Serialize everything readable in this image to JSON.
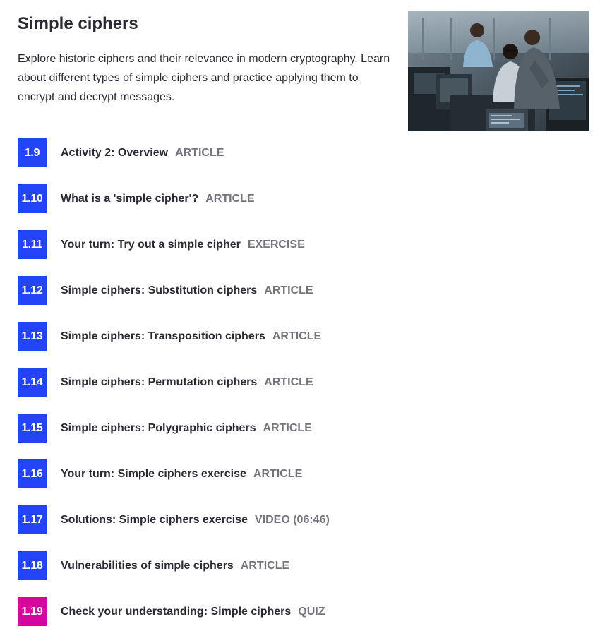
{
  "course": {
    "title": "Simple ciphers",
    "description": "Explore historic ciphers and their relevance in modern cryptography. Learn about different types of simple ciphers and practice applying them to encrypt and decrypt messages."
  },
  "colors": {
    "step_badge": "#2443f5",
    "quiz_badge": "#d4089e",
    "type_label": "#74737a",
    "text": "#2b2a33"
  },
  "steps": [
    {
      "number": "1.9",
      "title": "Activity 2: Overview",
      "type": "ARTICLE"
    },
    {
      "number": "1.10",
      "title": "What is a 'simple cipher'?",
      "type": "ARTICLE"
    },
    {
      "number": "1.11",
      "title": "Your turn: Try out a simple cipher",
      "type": "EXERCISE"
    },
    {
      "number": "1.12",
      "title": "Simple ciphers: Substitution ciphers",
      "type": "ARTICLE"
    },
    {
      "number": "1.13",
      "title": "Simple ciphers: Transposition ciphers",
      "type": "ARTICLE"
    },
    {
      "number": "1.14",
      "title": "Simple ciphers: Permutation ciphers",
      "type": "ARTICLE"
    },
    {
      "number": "1.15",
      "title": "Simple ciphers: Polygraphic ciphers",
      "type": "ARTICLE"
    },
    {
      "number": "1.16",
      "title": "Your turn: Simple ciphers exercise",
      "type": "ARTICLE"
    },
    {
      "number": "1.17",
      "title": "Solutions: Simple ciphers exercise",
      "type": "VIDEO (06:46)"
    },
    {
      "number": "1.18",
      "title": "Vulnerabilities of simple ciphers",
      "type": "ARTICLE"
    },
    {
      "number": "1.19",
      "title": "Check your understanding: Simple ciphers",
      "type": "QUIZ"
    }
  ]
}
